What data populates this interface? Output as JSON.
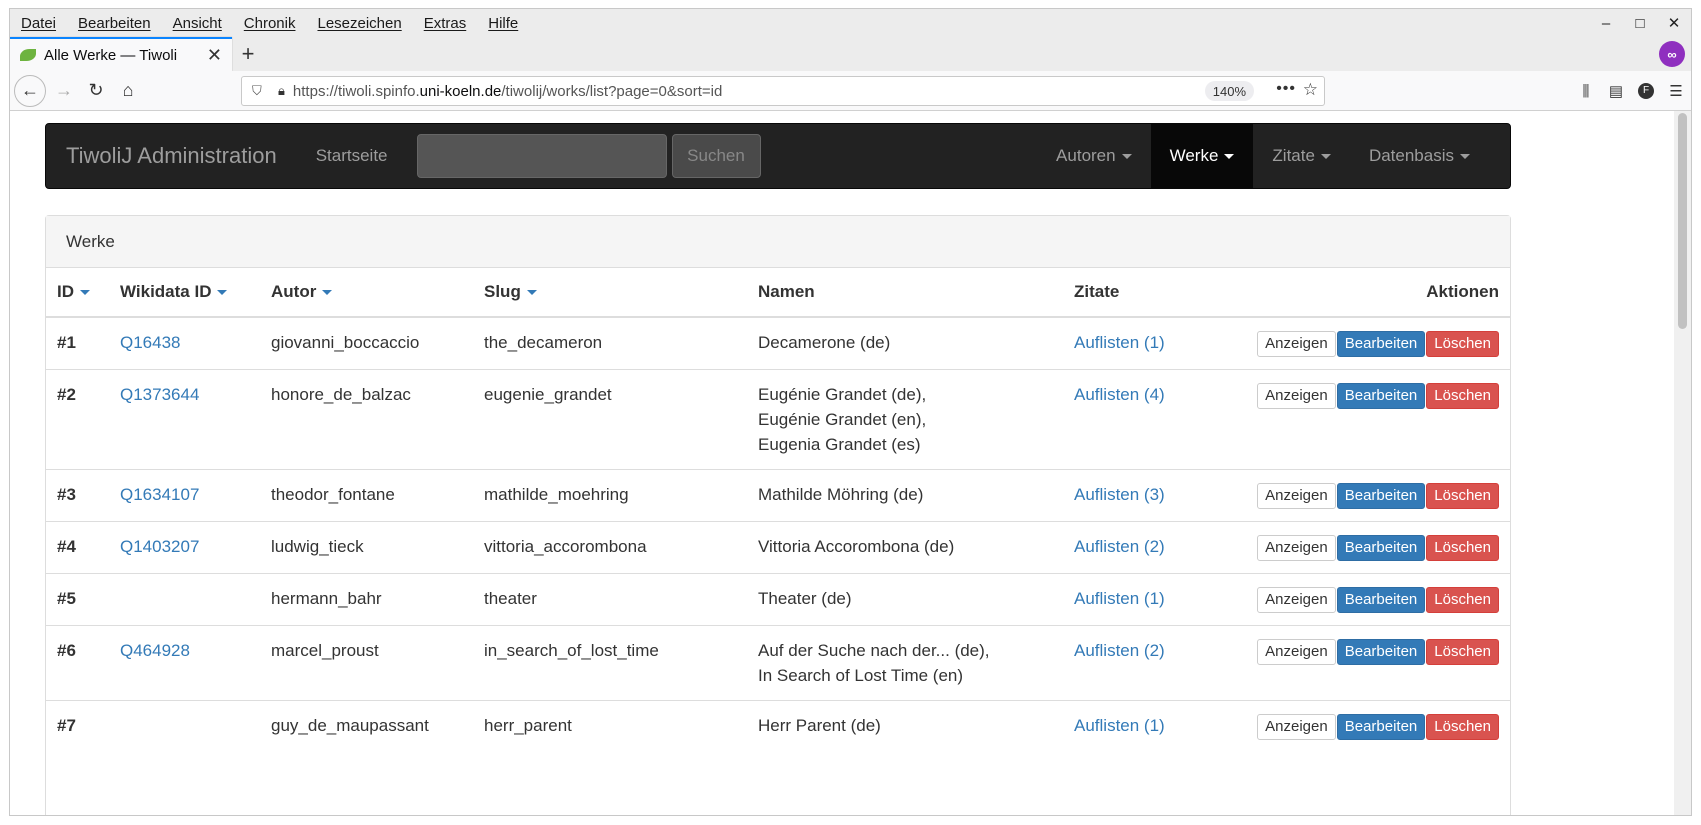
{
  "menubar": {
    "items": [
      "Datei",
      "Bearbeiten",
      "Ansicht",
      "Chronik",
      "Lesezeichen",
      "Extras",
      "Hilfe"
    ]
  },
  "window_controls": {
    "minimize": "–",
    "maximize": "□",
    "close": "✕"
  },
  "tab": {
    "title": "Alle Werke — Tiwoli",
    "close": "✕"
  },
  "newtab": "+",
  "url": {
    "prefix": "https://tiwoli.spinfo.",
    "domain": "uni-koeln.de",
    "path": "/tiwolij/works/list?page=0&sort=id",
    "zoom": "140%"
  },
  "toolbar": {
    "more": "•••",
    "star": "☆",
    "library": "⫼",
    "sidebar": "▤",
    "profile": "F",
    "menu": "☰"
  },
  "app": {
    "brand": "TiwoliJ Administration",
    "home": "Startseite",
    "search_button": "Suchen",
    "nav": [
      "Autoren",
      "Werke",
      "Zitate",
      "Datenbasis"
    ],
    "active_nav": "Werke"
  },
  "panel": {
    "title": "Werke"
  },
  "table": {
    "headers": {
      "id": "ID",
      "wikidata": "Wikidata ID",
      "autor": "Autor",
      "slug": "Slug",
      "namen": "Namen",
      "zitate": "Zitate",
      "aktionen": "Aktionen"
    },
    "buttons": {
      "show": "Anzeigen",
      "edit": "Bearbeiten",
      "delete": "Löschen"
    },
    "rows": [
      {
        "id": "#1",
        "wikidata": "Q16438",
        "autor": "giovanni_boccaccio",
        "slug": "the_decameron",
        "namen": [
          "Decamerone (de)"
        ],
        "zitate": "Auflisten (1)"
      },
      {
        "id": "#2",
        "wikidata": "Q1373644",
        "autor": "honore_de_balzac",
        "slug": "eugenie_grandet",
        "namen": [
          "Eugénie Grandet (de),",
          "Eugénie Grandet (en),",
          "Eugenia Grandet (es)"
        ],
        "zitate": "Auflisten (4)"
      },
      {
        "id": "#3",
        "wikidata": "Q1634107",
        "autor": "theodor_fontane",
        "slug": "mathilde_moehring",
        "namen": [
          "Mathilde Möhring (de)"
        ],
        "zitate": "Auflisten (3)"
      },
      {
        "id": "#4",
        "wikidata": "Q1403207",
        "autor": "ludwig_tieck",
        "slug": "vittoria_accorombona",
        "namen": [
          "Vittoria Accorombona (de)"
        ],
        "zitate": "Auflisten (2)"
      },
      {
        "id": "#5",
        "wikidata": "",
        "autor": "hermann_bahr",
        "slug": "theater",
        "namen": [
          "Theater (de)"
        ],
        "zitate": "Auflisten (1)"
      },
      {
        "id": "#6",
        "wikidata": "Q464928",
        "autor": "marcel_proust",
        "slug": "in_search_of_lost_time",
        "namen": [
          "Auf der Suche nach der... (de),",
          "In Search of Lost Time (en)"
        ],
        "zitate": "Auflisten (2)"
      },
      {
        "id": "#7",
        "wikidata": "",
        "autor": "guy_de_maupassant",
        "slug": "herr_parent",
        "namen": [
          "Herr Parent (de)"
        ],
        "zitate": "Auflisten (1)"
      }
    ]
  }
}
